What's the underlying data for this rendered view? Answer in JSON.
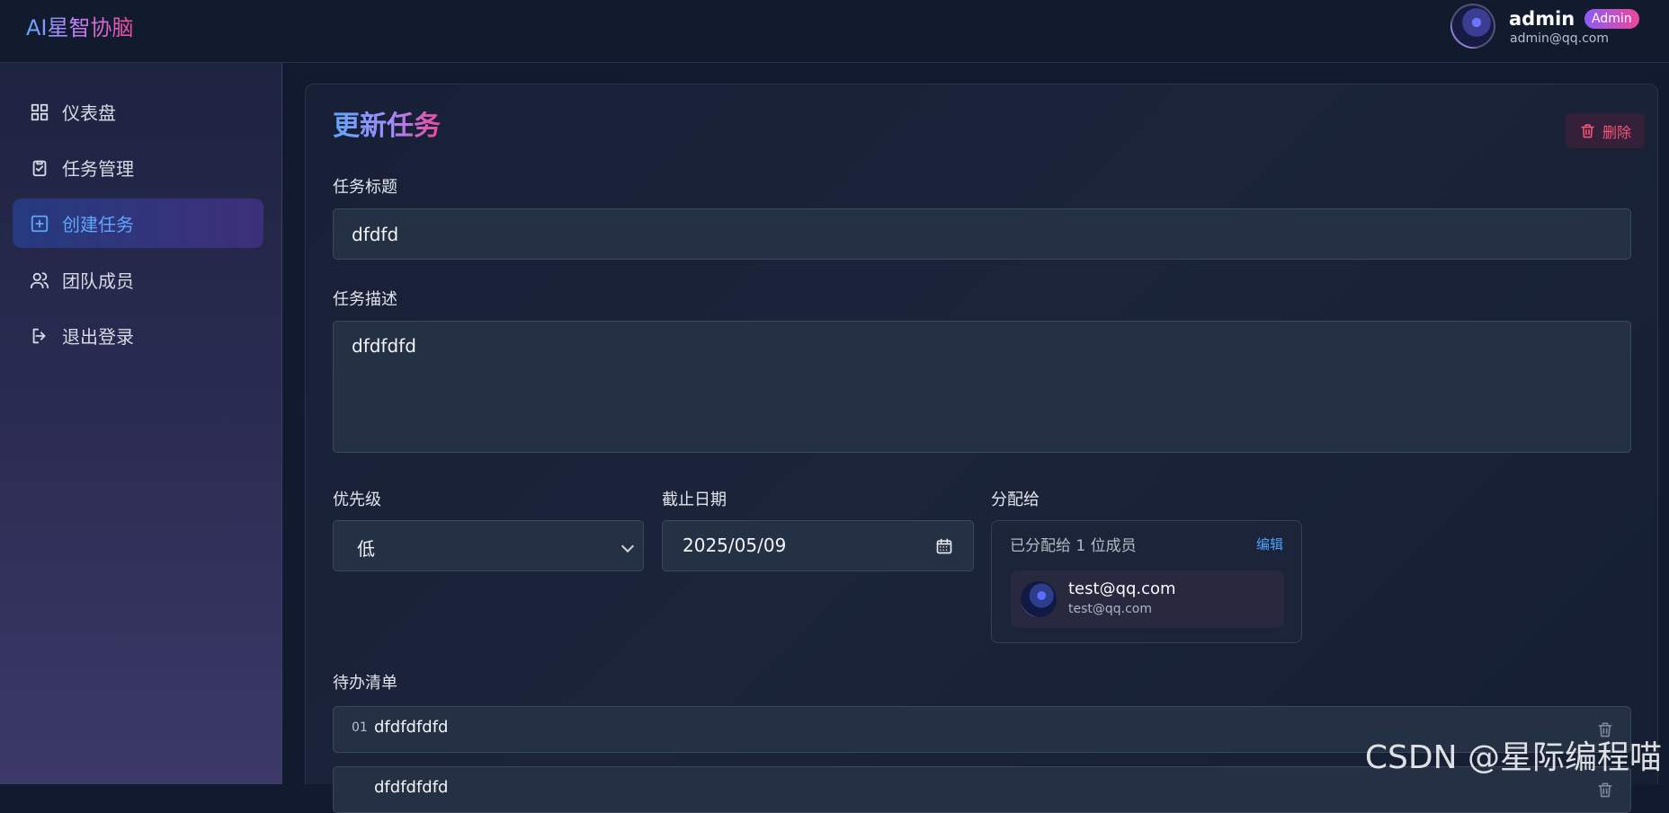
{
  "brand": {
    "title": "AI星智协脑"
  },
  "user": {
    "name": "admin",
    "role": "Admin",
    "email": "admin@qq.com"
  },
  "sidebar": {
    "items": [
      {
        "label": "仪表盘",
        "icon": "dashboard-icon"
      },
      {
        "label": "任务管理",
        "icon": "clipboard-check-icon"
      },
      {
        "label": "创建任务",
        "icon": "plus-square-icon",
        "active": true
      },
      {
        "label": "团队成员",
        "icon": "users-icon"
      },
      {
        "label": "退出登录",
        "icon": "logout-icon"
      }
    ]
  },
  "form": {
    "title": "更新任务",
    "delete_label": "删除",
    "task_title": {
      "label": "任务标题",
      "value": "dfdfd"
    },
    "description": {
      "label": "任务描述",
      "value": "dfdfdfd"
    },
    "priority": {
      "label": "优先级",
      "value": "低"
    },
    "due_date": {
      "label": "截止日期",
      "year": "2025",
      "month": "05",
      "day": "09"
    },
    "assignment": {
      "label": "分配给",
      "summary": "已分配给 1 位成员",
      "edit_label": "编辑",
      "members": [
        {
          "name": "test@qq.com",
          "email": "test@qq.com"
        }
      ]
    },
    "todos": {
      "label": "待办清单",
      "items": [
        {
          "number": "01",
          "text": "dfdfdfdfd"
        },
        {
          "number": "",
          "text": "dfdfdfdfd"
        }
      ]
    }
  },
  "watermark": "CSDN @星际编程喵",
  "colors": {
    "accent": "#60a5fa",
    "brand_pink": "#ec4899",
    "danger": "#f5567a"
  }
}
